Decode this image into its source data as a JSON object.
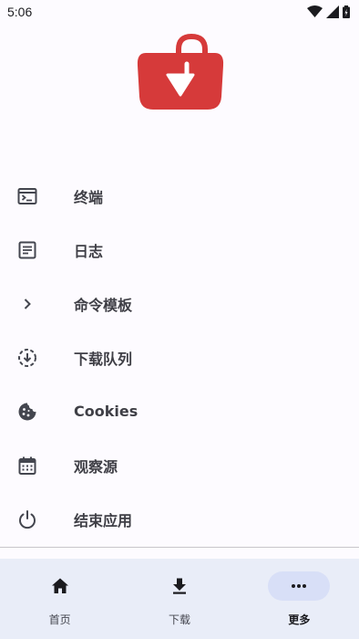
{
  "status_bar": {
    "time": "5:06"
  },
  "menu": {
    "items": [
      {
        "label": "终端",
        "icon": "terminal-icon"
      },
      {
        "label": "日志",
        "icon": "article-icon"
      },
      {
        "label": "命令模板",
        "icon": "chevron-right-icon"
      },
      {
        "label": "下载队列",
        "icon": "download-queue-icon"
      },
      {
        "label": "Cookies",
        "icon": "cookie-icon"
      },
      {
        "label": "观察源",
        "icon": "calendar-icon"
      },
      {
        "label": "结束应用",
        "icon": "power-icon"
      }
    ]
  },
  "bottom_nav": {
    "items": [
      {
        "label": "首页",
        "icon": "home-icon"
      },
      {
        "label": "下载",
        "icon": "download-icon"
      },
      {
        "label": "更多",
        "icon": "more-horiz-icon",
        "active": true
      }
    ]
  },
  "colors": {
    "background": "#fdfbff",
    "logo_red": "#d63a3a",
    "nav_background": "#e9edf8",
    "active_pill": "#d8dff7",
    "icon": "#44464f"
  }
}
